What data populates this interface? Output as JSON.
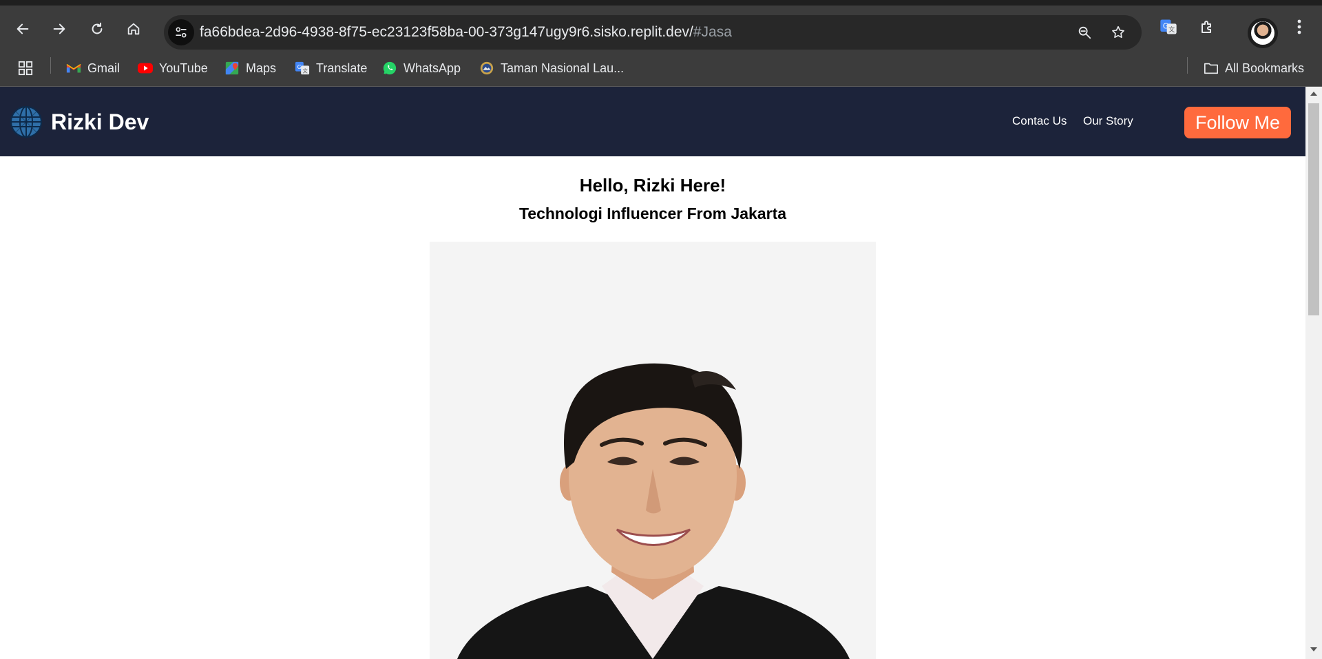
{
  "browser": {
    "url_main": "fa66bdea-2d96-4938-8f75-ec23123f58ba-00-373g147ugy9r6.sisko.replit.dev/",
    "url_fragment": "#Jasa",
    "bookmarks": [
      {
        "label": "Gmail",
        "icon": "gmail-icon"
      },
      {
        "label": "YouTube",
        "icon": "youtube-icon"
      },
      {
        "label": "Maps",
        "icon": "maps-icon"
      },
      {
        "label": "Translate",
        "icon": "translate-icon"
      },
      {
        "label": "WhatsApp",
        "icon": "whatsapp-icon"
      },
      {
        "label": "Taman Nasional Lau...",
        "icon": "park-badge-icon"
      }
    ],
    "all_bookmarks_label": "All Bookmarks"
  },
  "site": {
    "brand": "Rizki Dev",
    "nav": [
      "Contac Us",
      "Our Story"
    ],
    "cta": "Follow Me",
    "colors": {
      "header": "#1c233a",
      "cta": "#ff6a3d"
    }
  },
  "hero": {
    "title": "Hello, Rizki Here!",
    "subtitle": "Technologi Influencer From Jakarta"
  }
}
